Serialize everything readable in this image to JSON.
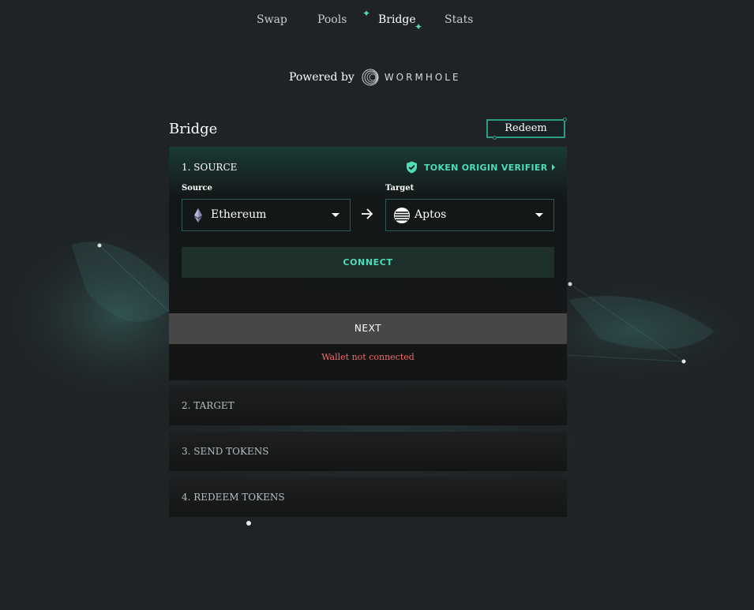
{
  "nav": {
    "items": [
      {
        "label": "Swap",
        "active": false
      },
      {
        "label": "Pools",
        "active": false
      },
      {
        "label": "Bridge",
        "active": true
      },
      {
        "label": "Stats",
        "active": false
      }
    ]
  },
  "powered": {
    "label": "Powered by",
    "brand": "WORMHOLE",
    "brand_icon": "wormhole-logo-icon"
  },
  "page": {
    "title": "Bridge",
    "redeem_label": "Redeem"
  },
  "source_step": {
    "title": "1. SOURCE",
    "verifier_label": "TOKEN ORIGIN VERIFIER",
    "verifier_icon": "shield-check-icon",
    "source_label": "Source",
    "source_value": "Ethereum",
    "source_icon": "ethereum-icon",
    "target_label": "Target",
    "target_value": "Aptos",
    "target_icon": "aptos-icon",
    "connect_label": "CONNECT",
    "next_label": "NEXT",
    "error_text": "Wallet not connected"
  },
  "steps": [
    {
      "label": "2. TARGET"
    },
    {
      "label": "3. SEND TOKENS"
    },
    {
      "label": "4. REDEEM TOKENS"
    }
  ],
  "colors": {
    "background": "#1f2326",
    "accent": "#4fdcb8",
    "border": "#2d9c86",
    "error": "#f26a6a",
    "next_button": "#474747",
    "connect_button": "#1d302c"
  }
}
